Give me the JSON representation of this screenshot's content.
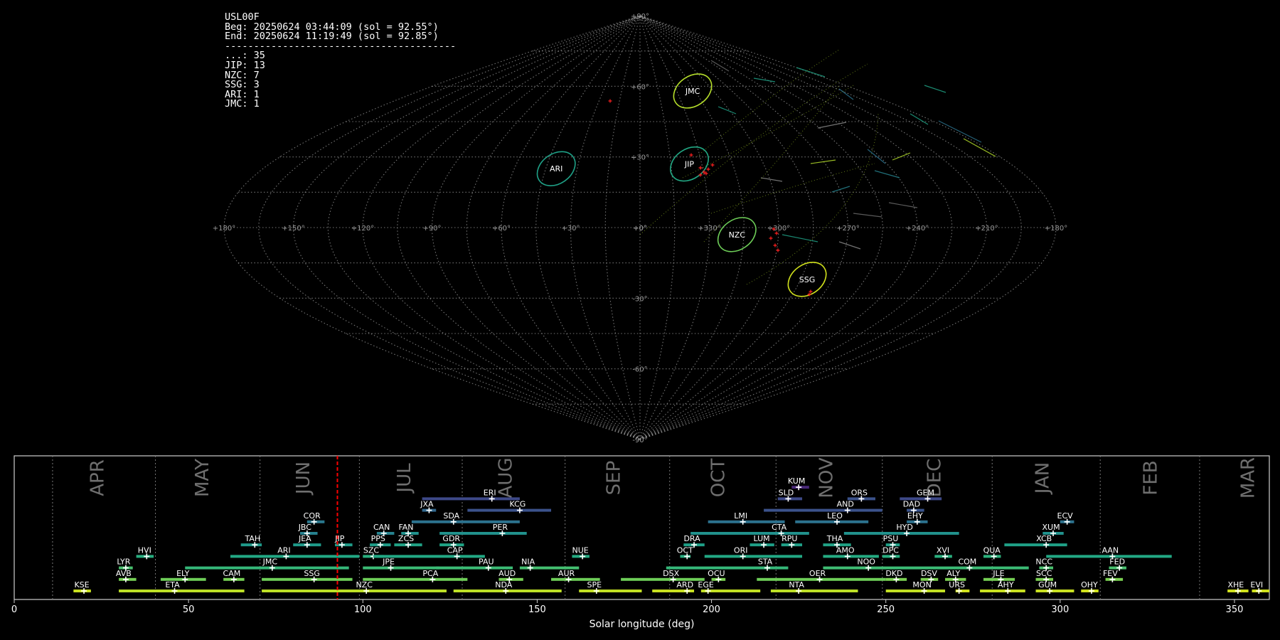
{
  "header": {
    "camera": "USL00F",
    "begin": "Beg: 20250624 03:44:09 (sol = 92.55°)",
    "end": "End: 20250624 11:19:49 (sol = 92.85°)",
    "divider": "----------------------------------------",
    "counts": [
      {
        "code": "...",
        "count": 35
      },
      {
        "code": "JIP",
        "count": 13
      },
      {
        "code": "NZC",
        "count": 7
      },
      {
        "code": "SSG",
        "count": 3
      },
      {
        "code": "ARI",
        "count": 1
      },
      {
        "code": "JMC",
        "count": 1
      }
    ]
  },
  "chart_data": [
    {
      "type": "scatter",
      "projection": "sinusoidal (all-sky)",
      "x_ticks": [
        "+180°",
        "+150°",
        "+120°",
        "+90°",
        "+60°",
        "+30°",
        "+0°",
        "+330°",
        "+300°",
        "+270°",
        "+240°",
        "+210°",
        "+180°"
      ],
      "y_ticks": [
        "+90°",
        "+60°",
        "+30°",
        "+0°",
        "-30°",
        "-60°",
        "-90°"
      ],
      "showers": [
        {
          "code": "JMC",
          "lon": 317,
          "lat": 58,
          "color": "#b5de2b"
        },
        {
          "code": "ARI",
          "lon": 40,
          "lat": 25,
          "color": "#1fa187"
        },
        {
          "code": "JIP",
          "lon": 336,
          "lat": 27,
          "color": "#22a884"
        },
        {
          "code": "NZC",
          "lon": 318,
          "lat": -3,
          "color": "#6ece58"
        },
        {
          "code": "SSG",
          "lon": 282,
          "lat": -22,
          "color": "#d0e11c"
        }
      ]
    },
    {
      "type": "bar",
      "xlabel": "Solar longitude (deg)",
      "xlim": [
        0,
        360
      ],
      "x_ticks": [
        0,
        50,
        100,
        150,
        200,
        250,
        300,
        350
      ],
      "current_sol": 92.7,
      "month_boundaries": [
        11,
        40.5,
        70.5,
        99,
        128.5,
        158,
        188,
        218.5,
        249,
        280.5,
        311.5,
        340
      ],
      "months": [
        {
          "label": "APR",
          "sol": 24
        },
        {
          "label": "MAY",
          "sol": 54
        },
        {
          "label": "JUN",
          "sol": 83
        },
        {
          "label": "JUL",
          "sol": 112
        },
        {
          "label": "AUG",
          "sol": 141
        },
        {
          "label": "SEP",
          "sol": 172
        },
        {
          "label": "OCT",
          "sol": 202
        },
        {
          "label": "NOV",
          "sol": 233
        },
        {
          "label": "DEC",
          "sol": 264
        },
        {
          "label": "JAN",
          "sol": 295
        },
        {
          "label": "FEB",
          "sol": 326
        },
        {
          "label": "MAR",
          "sol": 354
        }
      ],
      "showers": [
        {
          "code": "KUM",
          "start": 223,
          "end": 228,
          "peak": 225,
          "row": 9,
          "color": "#482878"
        },
        {
          "code": "ERI",
          "start": 117,
          "end": 145,
          "peak": 137,
          "row": 8,
          "color": "#3e4989"
        },
        {
          "code": "SLD",
          "start": 219,
          "end": 226,
          "peak": 222,
          "row": 8,
          "color": "#3e4a89"
        },
        {
          "code": "ORS",
          "start": 239,
          "end": 247,
          "peak": 243,
          "row": 8,
          "color": "#3b528b"
        },
        {
          "code": "GEM",
          "start": 254,
          "end": 266,
          "peak": 262,
          "row": 8,
          "color": "#3e4989"
        },
        {
          "code": "JXA",
          "start": 117,
          "end": 121,
          "peak": 119,
          "row": 7,
          "color": "#31688e"
        },
        {
          "code": "KCG",
          "start": 130,
          "end": 154,
          "peak": 145,
          "row": 7,
          "color": "#3b528b"
        },
        {
          "code": "AND",
          "start": 215,
          "end": 249,
          "peak": 239,
          "row": 7,
          "color": "#3b528b"
        },
        {
          "code": "DAD",
          "start": 256,
          "end": 261,
          "peak": 258,
          "row": 7,
          "color": "#3a548c"
        },
        {
          "code": "COR",
          "start": 84,
          "end": 89,
          "peak": 86,
          "row": 6,
          "color": "#2a788e"
        },
        {
          "code": "SDA",
          "start": 114,
          "end": 145,
          "peak": 126,
          "row": 6,
          "color": "#2c728e"
        },
        {
          "code": "LMI",
          "start": 199,
          "end": 221,
          "peak": 209,
          "row": 6,
          "color": "#2c718e"
        },
        {
          "code": "LEO",
          "start": 224,
          "end": 245,
          "peak": 236,
          "row": 6,
          "color": "#2c728e"
        },
        {
          "code": "EHY",
          "start": 256,
          "end": 262,
          "peak": 259,
          "row": 6,
          "color": "#2c718e"
        },
        {
          "code": "ECV",
          "start": 300,
          "end": 304,
          "peak": 302,
          "row": 6,
          "color": "#2c728e"
        },
        {
          "code": "JBC",
          "start": 82,
          "end": 87,
          "peak": 84,
          "row": 5,
          "color": "#26818e"
        },
        {
          "code": "CAN",
          "start": 104,
          "end": 109,
          "peak": 106,
          "row": 5,
          "color": "#26828e"
        },
        {
          "code": "FAN",
          "start": 111,
          "end": 116,
          "peak": 113,
          "row": 5,
          "color": "#21918c"
        },
        {
          "code": "PER",
          "start": 122,
          "end": 147,
          "peak": 140,
          "row": 5,
          "color": "#21918c"
        },
        {
          "code": "CTA",
          "start": 194,
          "end": 228,
          "peak": 220,
          "row": 5,
          "color": "#21918c"
        },
        {
          "code": "HYD",
          "start": 238,
          "end": 271,
          "peak": 256,
          "row": 5,
          "color": "#21918c"
        },
        {
          "code": "XUM",
          "start": 295,
          "end": 301,
          "peak": 298,
          "row": 5,
          "color": "#21918c"
        },
        {
          "code": "TAH",
          "start": 65,
          "end": 71,
          "peak": 69,
          "row": 4,
          "color": "#1f9a8a"
        },
        {
          "code": "JEA",
          "start": 80,
          "end": 88,
          "peak": 84,
          "row": 4,
          "color": "#1e9b8a"
        },
        {
          "code": "JIP",
          "start": 92,
          "end": 97,
          "peak": 94,
          "row": 4,
          "color": "#1f9e89"
        },
        {
          "code": "PPS",
          "start": 102,
          "end": 108,
          "peak": 105,
          "row": 4,
          "color": "#1f9e89"
        },
        {
          "code": "ZCS",
          "start": 109,
          "end": 117,
          "peak": 113,
          "row": 4,
          "color": "#20a386"
        },
        {
          "code": "GDR",
          "start": 122,
          "end": 129,
          "peak": 126,
          "row": 4,
          "color": "#20a486"
        },
        {
          "code": "DRA",
          "start": 192,
          "end": 198,
          "peak": 195,
          "row": 4,
          "color": "#1fa188"
        },
        {
          "code": "LUM",
          "start": 211,
          "end": 218,
          "peak": 215,
          "row": 4,
          "color": "#1fa088"
        },
        {
          "code": "RPU",
          "start": 220,
          "end": 226,
          "peak": 223,
          "row": 4,
          "color": "#1fa188"
        },
        {
          "code": "THA",
          "start": 232,
          "end": 240,
          "peak": 236,
          "row": 4,
          "color": "#20a386"
        },
        {
          "code": "PSU",
          "start": 250,
          "end": 254,
          "peak": 252,
          "row": 4,
          "color": "#1fa188"
        },
        {
          "code": "XCB",
          "start": 284,
          "end": 302,
          "peak": 296,
          "row": 4,
          "color": "#1fa187"
        },
        {
          "code": "HVI",
          "start": 35,
          "end": 40,
          "peak": 38,
          "row": 3,
          "color": "#28ae80"
        },
        {
          "code": "ARI",
          "start": 62,
          "end": 99,
          "peak": 78,
          "row": 3,
          "color": "#22a884"
        },
        {
          "code": "SZC",
          "start": 100,
          "end": 106,
          "peak": 103,
          "row": 3,
          "color": "#29af7f"
        },
        {
          "code": "CAP",
          "start": 103,
          "end": 135,
          "peak": 127,
          "row": 3,
          "color": "#22a884"
        },
        {
          "code": "NUE",
          "start": 160,
          "end": 165,
          "peak": 163,
          "row": 3,
          "color": "#25ab82"
        },
        {
          "code": "OCT",
          "start": 191,
          "end": 194,
          "peak": 193,
          "row": 3,
          "color": "#28ae80"
        },
        {
          "code": "ORI",
          "start": 198,
          "end": 226,
          "peak": 209,
          "row": 3,
          "color": "#22a884"
        },
        {
          "code": "AMO",
          "start": 232,
          "end": 248,
          "peak": 239,
          "row": 3,
          "color": "#25ab82"
        },
        {
          "code": "DPC",
          "start": 249,
          "end": 254,
          "peak": 252,
          "row": 3,
          "color": "#28ae80"
        },
        {
          "code": "XVI",
          "start": 264,
          "end": 269,
          "peak": 267,
          "row": 3,
          "color": "#2ab07f"
        },
        {
          "code": "QUA",
          "start": 278,
          "end": 283,
          "peak": 281,
          "row": 3,
          "color": "#2db27d"
        },
        {
          "code": "AAN",
          "start": 296,
          "end": 332,
          "peak": 315,
          "row": 3,
          "color": "#22a884"
        },
        {
          "code": "LYR",
          "start": 30,
          "end": 34,
          "peak": 32,
          "row": 2,
          "color": "#48c16e"
        },
        {
          "code": "JMC",
          "start": 49,
          "end": 96,
          "peak": 74,
          "row": 2,
          "color": "#35b779"
        },
        {
          "code": "JPE",
          "start": 100,
          "end": 122,
          "peak": 108,
          "row": 2,
          "color": "#3bbb75"
        },
        {
          "code": "PAU",
          "start": 121,
          "end": 143,
          "peak": 136,
          "row": 2,
          "color": "#3bbb75"
        },
        {
          "code": "NIA",
          "start": 145,
          "end": 162,
          "peak": 148,
          "row": 2,
          "color": "#44bf70"
        },
        {
          "code": "STA",
          "start": 187,
          "end": 222,
          "peak": 216,
          "row": 2,
          "color": "#35b779"
        },
        {
          "code": "NOO",
          "start": 232,
          "end": 252,
          "peak": 245,
          "row": 2,
          "color": "#3fbc73"
        },
        {
          "code": "COM",
          "start": 252,
          "end": 291,
          "peak": 274,
          "row": 2,
          "color": "#3bbb75"
        },
        {
          "code": "NCC",
          "start": 294,
          "end": 298,
          "peak": 296,
          "row": 2,
          "color": "#48c16e"
        },
        {
          "code": "FED",
          "start": 314,
          "end": 319,
          "peak": 317,
          "row": 2,
          "color": "#48c16e"
        },
        {
          "code": "AVB",
          "start": 30,
          "end": 35,
          "peak": 32,
          "row": 1,
          "color": "#75d054"
        },
        {
          "code": "ELY",
          "start": 42,
          "end": 55,
          "peak": 49,
          "row": 1,
          "color": "#6ece58"
        },
        {
          "code": "CAM",
          "start": 60,
          "end": 66,
          "peak": 63,
          "row": 1,
          "color": "#75d054"
        },
        {
          "code": "SSG",
          "start": 71,
          "end": 97,
          "peak": 86,
          "row": 1,
          "color": "#6ece58"
        },
        {
          "code": "PCA",
          "start": 100,
          "end": 130,
          "peak": 120,
          "row": 1,
          "color": "#6ece58"
        },
        {
          "code": "AUD",
          "start": 139,
          "end": 146,
          "peak": 142,
          "row": 1,
          "color": "#75d054"
        },
        {
          "code": "AUR",
          "start": 154,
          "end": 168,
          "peak": 159,
          "row": 1,
          "color": "#6ece58"
        },
        {
          "code": "DSX",
          "start": 174,
          "end": 198,
          "peak": 189,
          "row": 1,
          "color": "#6ece58"
        },
        {
          "code": "OCU",
          "start": 200,
          "end": 204,
          "peak": 202,
          "row": 1,
          "color": "#79d151"
        },
        {
          "code": "OER",
          "start": 213,
          "end": 250,
          "peak": 231,
          "row": 1,
          "color": "#6ece58"
        },
        {
          "code": "DKD",
          "start": 250,
          "end": 256,
          "peak": 253,
          "row": 1,
          "color": "#7ad151"
        },
        {
          "code": "DSV",
          "start": 260,
          "end": 265,
          "peak": 263,
          "row": 1,
          "color": "#7ad151"
        },
        {
          "code": "ALY",
          "start": 267,
          "end": 273,
          "peak": 270,
          "row": 1,
          "color": "#7ad151"
        },
        {
          "code": "JLE",
          "start": 278,
          "end": 287,
          "peak": 283,
          "row": 1,
          "color": "#75d054"
        },
        {
          "code": "SCC",
          "start": 293,
          "end": 298,
          "peak": 296,
          "row": 1,
          "color": "#7ad151"
        },
        {
          "code": "FEV",
          "start": 313,
          "end": 318,
          "peak": 315,
          "row": 1,
          "color": "#7ad151"
        },
        {
          "code": "KSE",
          "start": 17,
          "end": 22,
          "peak": 20,
          "row": 0,
          "color": "#c8e020"
        },
        {
          "code": "ETA",
          "start": 30,
          "end": 66,
          "peak": 46,
          "row": 0,
          "color": "#bddf26"
        },
        {
          "code": "NZC",
          "start": 71,
          "end": 124,
          "peak": 101,
          "row": 0,
          "color": "#bddf26"
        },
        {
          "code": "NDA",
          "start": 126,
          "end": 157,
          "peak": 141,
          "row": 0,
          "color": "#bddf26"
        },
        {
          "code": "SPE",
          "start": 162,
          "end": 180,
          "peak": 167,
          "row": 0,
          "color": "#c2df23"
        },
        {
          "code": "ARD",
          "start": 183,
          "end": 195,
          "peak": 193,
          "row": 0,
          "color": "#c8e020"
        },
        {
          "code": "EGE",
          "start": 197,
          "end": 214,
          "peak": 199,
          "row": 0,
          "color": "#c2df23"
        },
        {
          "code": "NTA",
          "start": 217,
          "end": 242,
          "peak": 225,
          "row": 0,
          "color": "#bddf26"
        },
        {
          "code": "MON",
          "start": 250,
          "end": 267,
          "peak": 261,
          "row": 0,
          "color": "#c2df23"
        },
        {
          "code": "URS",
          "start": 270,
          "end": 274,
          "peak": 271,
          "row": 0,
          "color": "#d0e11c"
        },
        {
          "code": "AHY",
          "start": 277,
          "end": 290,
          "peak": 285,
          "row": 0,
          "color": "#c8e020"
        },
        {
          "code": "GUM",
          "start": 293,
          "end": 304,
          "peak": 297,
          "row": 0,
          "color": "#c8e020"
        },
        {
          "code": "OHY",
          "start": 306,
          "end": 311,
          "peak": 309,
          "row": 0,
          "color": "#d0e11c"
        },
        {
          "code": "XHE",
          "start": 348,
          "end": 354,
          "peak": 351,
          "row": 0,
          "color": "#d0e11c"
        },
        {
          "code": "EVI",
          "start": 355,
          "end": 360,
          "peak": 357,
          "row": 0,
          "color": "#d0e11c"
        }
      ]
    }
  ],
  "colors": {
    "grid": "#9a9a9a",
    "marker": "#ff2020",
    "current_sol_line": "#ff0000",
    "timeline_frame": "#cfcfcf"
  }
}
